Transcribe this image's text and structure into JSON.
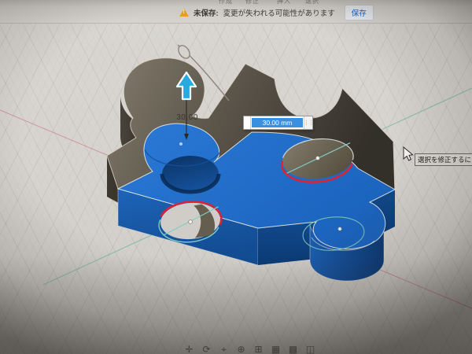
{
  "toolbar_fragments": {
    "labels": [
      "作成",
      "修正",
      "挿入",
      "選択"
    ]
  },
  "alert_bar": {
    "warning_icon": "warning-triangle",
    "title": "未保存:",
    "message": "変更が失われる可能性があります",
    "save_label": "保存"
  },
  "viewport": {
    "extrude_dimension_label": "30.00",
    "dimension_input_value": "30.00 mm",
    "drag_handle_icon": "⋮⋮",
    "tooltip_text": "選択を修正するには",
    "manipulator": "extrude-arrow-up",
    "selected_body": "puzzle-piece-extrusion"
  },
  "nav_bar": {
    "icons": [
      {
        "name": "pan",
        "glyph": "✛"
      },
      {
        "name": "orbit",
        "glyph": "⟳"
      },
      {
        "name": "look-at",
        "glyph": "⌖"
      },
      {
        "name": "zoom",
        "glyph": "⊕"
      },
      {
        "name": "fit",
        "glyph": "⊞"
      },
      {
        "name": "display-settings",
        "glyph": "▦"
      },
      {
        "name": "grid-settings",
        "glyph": "▩"
      },
      {
        "name": "viewports",
        "glyph": "◫"
      }
    ]
  },
  "colors": {
    "selection-blue": "#1b66c2",
    "selection-blue-ui": "#3a8fe0",
    "highlight-red": "#e41f2e",
    "construction-teal": "#82cec2",
    "manipulator-blue": "#2aa9e0",
    "save-link-blue": "#1a66c8",
    "warning-orange": "#eca31e",
    "axis-red": "#c85a64",
    "axis-green": "#5aaf9b"
  }
}
